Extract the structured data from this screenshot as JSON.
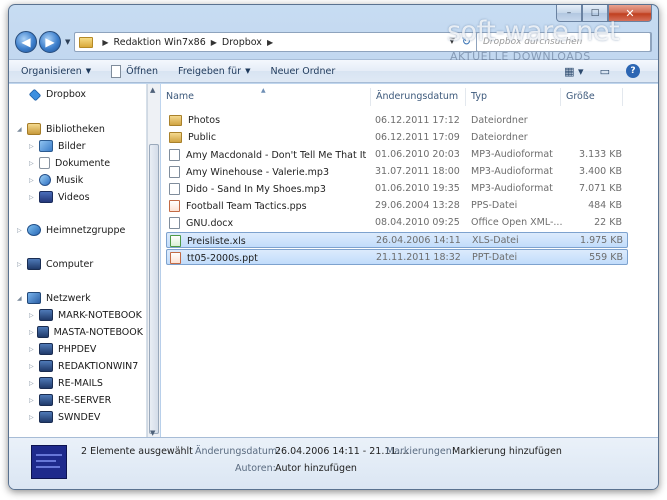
{
  "window": {
    "caption_buttons": [
      "–",
      "□",
      "✕"
    ]
  },
  "address": {
    "crumbs": [
      "Redaktion Win7x86",
      "Dropbox"
    ],
    "search_placeholder": "Dropbox durchsuchen"
  },
  "toolbar": {
    "organize": "Organisieren",
    "open": "Öffnen",
    "share": "Freigeben für",
    "new_folder": "Neuer Ordner"
  },
  "nav": {
    "favorites": [
      {
        "label": "Dropbox",
        "icon": "dropbox-icon"
      }
    ],
    "libraries": {
      "label": "Bibliotheken",
      "items": [
        {
          "label": "Bilder",
          "icon": "pictures-icon"
        },
        {
          "label": "Dokumente",
          "icon": "documents-icon"
        },
        {
          "label": "Musik",
          "icon": "music-icon"
        },
        {
          "label": "Videos",
          "icon": "videos-icon"
        }
      ]
    },
    "homegroup": "Heimnetzgruppe",
    "computer": "Computer",
    "network": {
      "label": "Netzwerk",
      "items": [
        "MARK-NOTEBOOK",
        "MASTA-NOTEBOOK",
        "PHPDEV",
        "REDAKTIONWIN7",
        "RE-MAILS",
        "RE-SERVER",
        "SWNDEV"
      ]
    }
  },
  "columns": {
    "name": "Name",
    "date": "Änderungsdatum",
    "type": "Typ",
    "size": "Größe"
  },
  "files": [
    {
      "name": "Photos",
      "date": "06.12.2011 17:12",
      "type": "Dateiordner",
      "size": "",
      "kind": "folder",
      "selected": false
    },
    {
      "name": "Public",
      "date": "06.12.2011 17:09",
      "type": "Dateiordner",
      "size": "",
      "kind": "folder",
      "selected": false
    },
    {
      "name": "Amy Macdonald - Don't Tell Me That It's...",
      "date": "01.06.2010 20:03",
      "type": "MP3-Audioformat",
      "size": "3.133 KB",
      "kind": "mp3",
      "selected": false
    },
    {
      "name": "Amy Winehouse - Valerie.mp3",
      "date": "31.07.2011 18:00",
      "type": "MP3-Audioformat",
      "size": "3.400 KB",
      "kind": "mp3",
      "selected": false
    },
    {
      "name": "Dido - Sand In My Shoes.mp3",
      "date": "01.06.2010 19:35",
      "type": "MP3-Audioformat",
      "size": "7.071 KB",
      "kind": "mp3",
      "selected": false
    },
    {
      "name": "Football Team Tactics.pps",
      "date": "29.06.2004 13:28",
      "type": "PPS-Datei",
      "size": "484 KB",
      "kind": "pps",
      "selected": false
    },
    {
      "name": "GNU.docx",
      "date": "08.04.2010 09:25",
      "type": "Office Open XML-...",
      "size": "22 KB",
      "kind": "docx",
      "selected": false
    },
    {
      "name": "Preisliste.xls",
      "date": "26.04.2006 14:11",
      "type": "XLS-Datei",
      "size": "1.975 KB",
      "kind": "xls",
      "selected": true
    },
    {
      "name": "tt05-2000s.ppt",
      "date": "21.11.2011 18:32",
      "type": "PPT-Datei",
      "size": "559 KB",
      "kind": "ppt",
      "selected": true
    }
  ],
  "details": {
    "count": "2 Elemente ausgewählt",
    "date_label": "Änderungsdatum:",
    "date_value": "26.04.2006 14:11 - 21.11....",
    "tags_label": "Markierungen:",
    "tags_value": "Markierung hinzufügen",
    "authors_label": "Autoren:",
    "authors_value": "Autor hinzufügen"
  },
  "watermark": {
    "main": "soft-ware.net",
    "sub": "AKTUELLE DOWNLOADS"
  }
}
